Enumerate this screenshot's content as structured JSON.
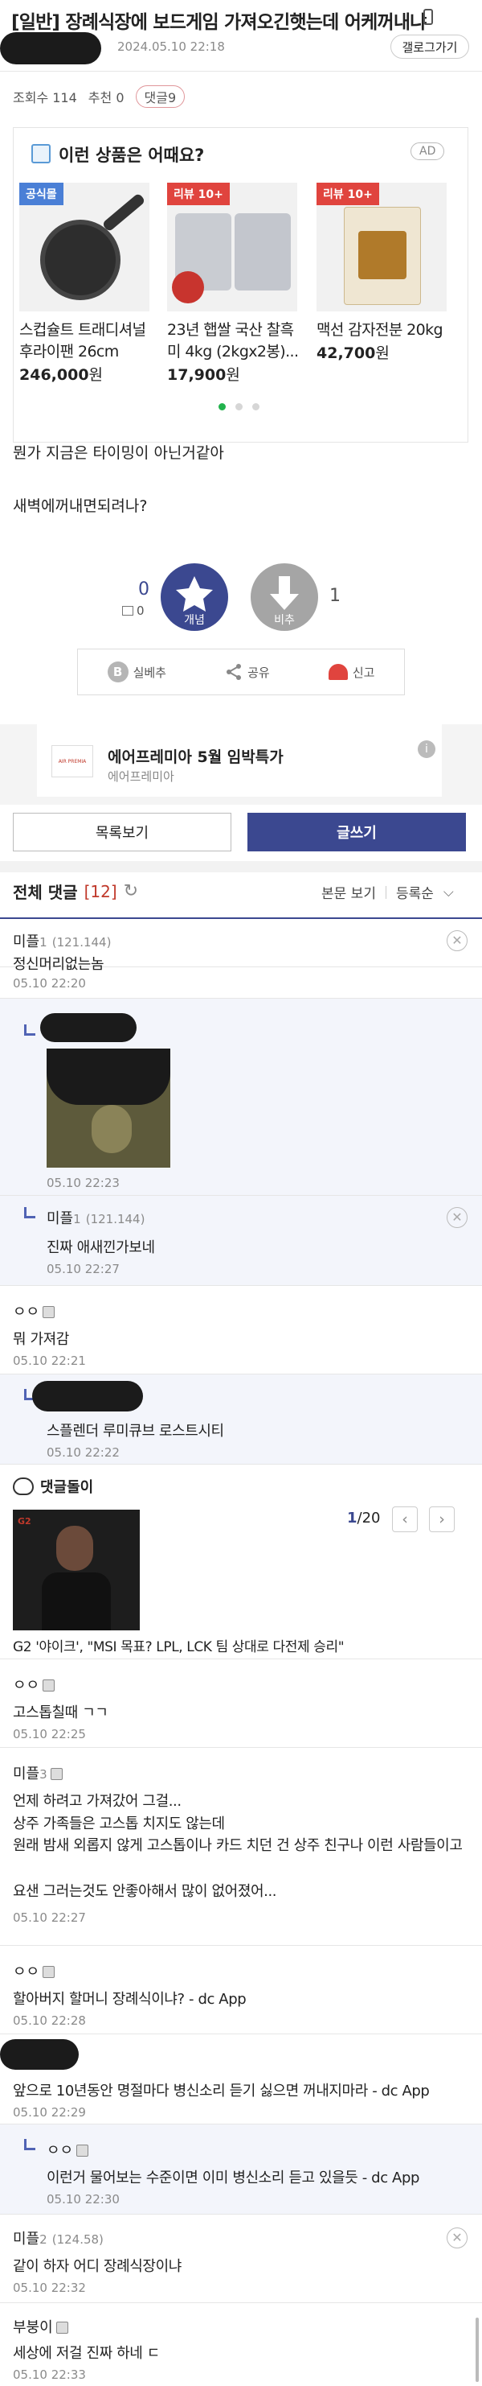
{
  "post": {
    "title": "[일반] 장례식장에 보드게임 가져오긴햇는데 어케꺼내냐",
    "date": "2024.05.10 22:18",
    "gallery_btn": "갤로그가기",
    "views": "조회수 114",
    "recommend": "추천 0",
    "comments_badge": "댓글9",
    "body": [
      "뭔가 지금은 타이밍이 아닌거같아",
      "새벽에꺼내면되려나?"
    ],
    "vote_up": "0",
    "vote_up_sub": "0",
    "vote_up_label": "개념",
    "vote_down_label": "비추",
    "vote_down": "1",
    "actions": {
      "real": "실베추",
      "share": "공유",
      "report": "신고"
    }
  },
  "ad": {
    "title": "이런 상품은 어때요?",
    "badge": "AD",
    "products": [
      {
        "tag": "공식몰",
        "tag_color": "#4a7fd6",
        "name": "스컵슐트 트래디셔널 후라이팬 26cm",
        "price": "246,000",
        "unit": "원"
      },
      {
        "tag": "리뷰 10+",
        "tag_color": "#e0443e",
        "name": "23년 햅쌀 국산 찰흑미 4kg (2kgx2봉)...",
        "price": "17,900",
        "unit": "원"
      },
      {
        "tag": "리뷰 10+",
        "tag_color": "#e0443e",
        "name": "맥선 감자전분 20kg",
        "price": "42,700",
        "unit": "원"
      }
    ]
  },
  "banner": {
    "title": "에어프레미아 5월 임박특가",
    "sub": "에어프레미아",
    "logo": "AIR PREMIA"
  },
  "buttons": {
    "list": "목록보기",
    "write": "글쓰기"
  },
  "comments_header": {
    "label": "전체 댓글",
    "count": "[12]",
    "view": "본문 보기",
    "sort": "등록순"
  },
  "comments": [
    {
      "nick": "미플",
      "num": "1",
      "ip": "(121.144)",
      "text": "정신머리없는놈",
      "time": "05.10 22:20"
    },
    {
      "time": "05.10 22:23"
    },
    {
      "nick": "미플",
      "num": "1",
      "ip": "(121.144)",
      "text": "진짜 애새낀가보네",
      "time": "05.10 22:27"
    },
    {
      "nick": "ㅇㅇ",
      "text": "뭐 가져감",
      "time": "05.10 22:21"
    },
    {
      "text": "스플렌더 루미큐브 로스트시티",
      "time": "05.10 22:22"
    },
    {
      "nick": "ㅇㅇ",
      "text": "고스톱칠때 ㄱㄱ",
      "time": "05.10 22:25"
    },
    {
      "nick": "미플",
      "num": "3",
      "lines": [
        "언제 하려고 가져갔어 그걸...",
        "상주 가족들은 고스톱 치지도 않는데",
        "원래 밤새 외롭지 않게 고스톱이나 카드 치던 건 상주 친구나 이런 사람들이고",
        "요샌 그러는것도 안좋아해서 많이 없어졌어..."
      ],
      "time": "05.10 22:27"
    },
    {
      "nick": "ㅇㅇ",
      "text": "할아버지 할머니 장례식이냐? - dc App",
      "time": "05.10 22:28"
    },
    {
      "text": "앞으로 10년동안 명절마다 병신소리 듣기 싫으면 꺼내지마라 - dc App",
      "time": "05.10 22:29"
    },
    {
      "nick": "ㅇㅇ",
      "text": "이런거 물어보는 수준이면 이미 병신소리 듣고 있을듯 - dc App",
      "time": "05.10 22:30"
    },
    {
      "nick": "미플",
      "num": "2",
      "ip": "(124.58)",
      "text": "같이 하자 어디 장례식장이냐",
      "time": "05.10 22:32"
    },
    {
      "nick": "부붕이",
      "text": "세상에 저걸 진짜 하네 ㄷ",
      "time": "05.10 22:33"
    }
  ],
  "dol": {
    "label": "댓글돌이",
    "page": "1",
    "total": "/20",
    "news": "G2 '야이크', \"MSI 목표? LPL, LCK 팀 상대로 다전제 승리\"",
    "img_text": "G2"
  }
}
